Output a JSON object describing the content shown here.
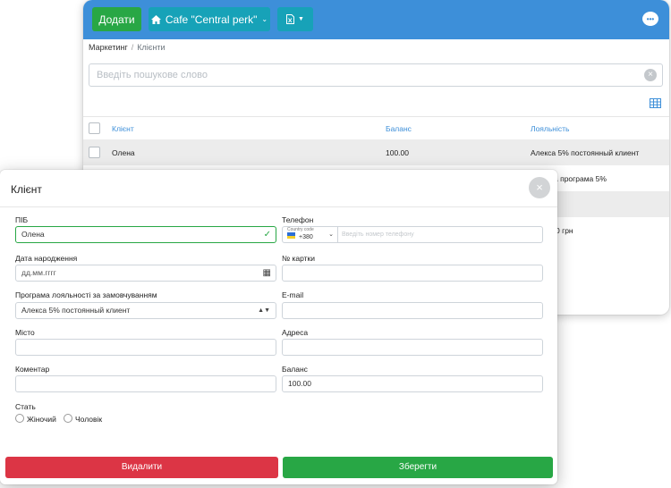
{
  "topbar": {
    "add_label": "Додати",
    "cafe_label": "Cafe \"Central perk\"",
    "excel_icon": "excel-file-icon",
    "chat_icon": "chat-bubble-icon",
    "color": "#3d8fd9"
  },
  "breadcrumb": {
    "section": "Маркетинг",
    "page": "Клієнти"
  },
  "search": {
    "placeholder": "Введіть пошукове слово",
    "value": ""
  },
  "table": {
    "columns": {
      "client": "Клієнт",
      "balance": "Баланс",
      "loyalty": "Лояльність"
    },
    "rows": [
      {
        "client": "Олена",
        "balance": "100.00",
        "loyalty": "Алекса 5% постоянный клиент"
      },
      {
        "client": "",
        "balance": "",
        "loyalty": "а програма 5%"
      },
      {
        "client": "",
        "balance": "",
        "loyalty": ""
      },
      {
        "client": "",
        "balance": "",
        "loyalty": "0 грн"
      }
    ]
  },
  "modal": {
    "title": "Клієнт",
    "fields": {
      "name": {
        "label": "ПІБ",
        "value": "Олена"
      },
      "phone": {
        "label": "Телефон",
        "country_code_label": "Country code",
        "country_code": "+380",
        "placeholder": "Введіть номер телефону"
      },
      "birthdate": {
        "label": "Дата народження",
        "placeholder": "дд.мм.гггг"
      },
      "card": {
        "label": "№ картки",
        "value": ""
      },
      "loyalty": {
        "label": "Програма лояльності за замовчуванням",
        "value": "Алекса 5% постоянный клиент"
      },
      "email": {
        "label": "E-mail",
        "value": ""
      },
      "city": {
        "label": "Місто",
        "value": ""
      },
      "address": {
        "label": "Адреса",
        "value": ""
      },
      "comment": {
        "label": "Коментар",
        "value": ""
      },
      "balance": {
        "label": "Баланс",
        "value": "100.00"
      },
      "gender": {
        "label": "Стать",
        "options": [
          "Жіночий",
          "Чоловік"
        ]
      }
    },
    "buttons": {
      "delete": "Видалити",
      "save": "Зберегти"
    },
    "colors": {
      "danger": "#dc3545",
      "success": "#28a745",
      "info": "#17a2b8"
    }
  }
}
